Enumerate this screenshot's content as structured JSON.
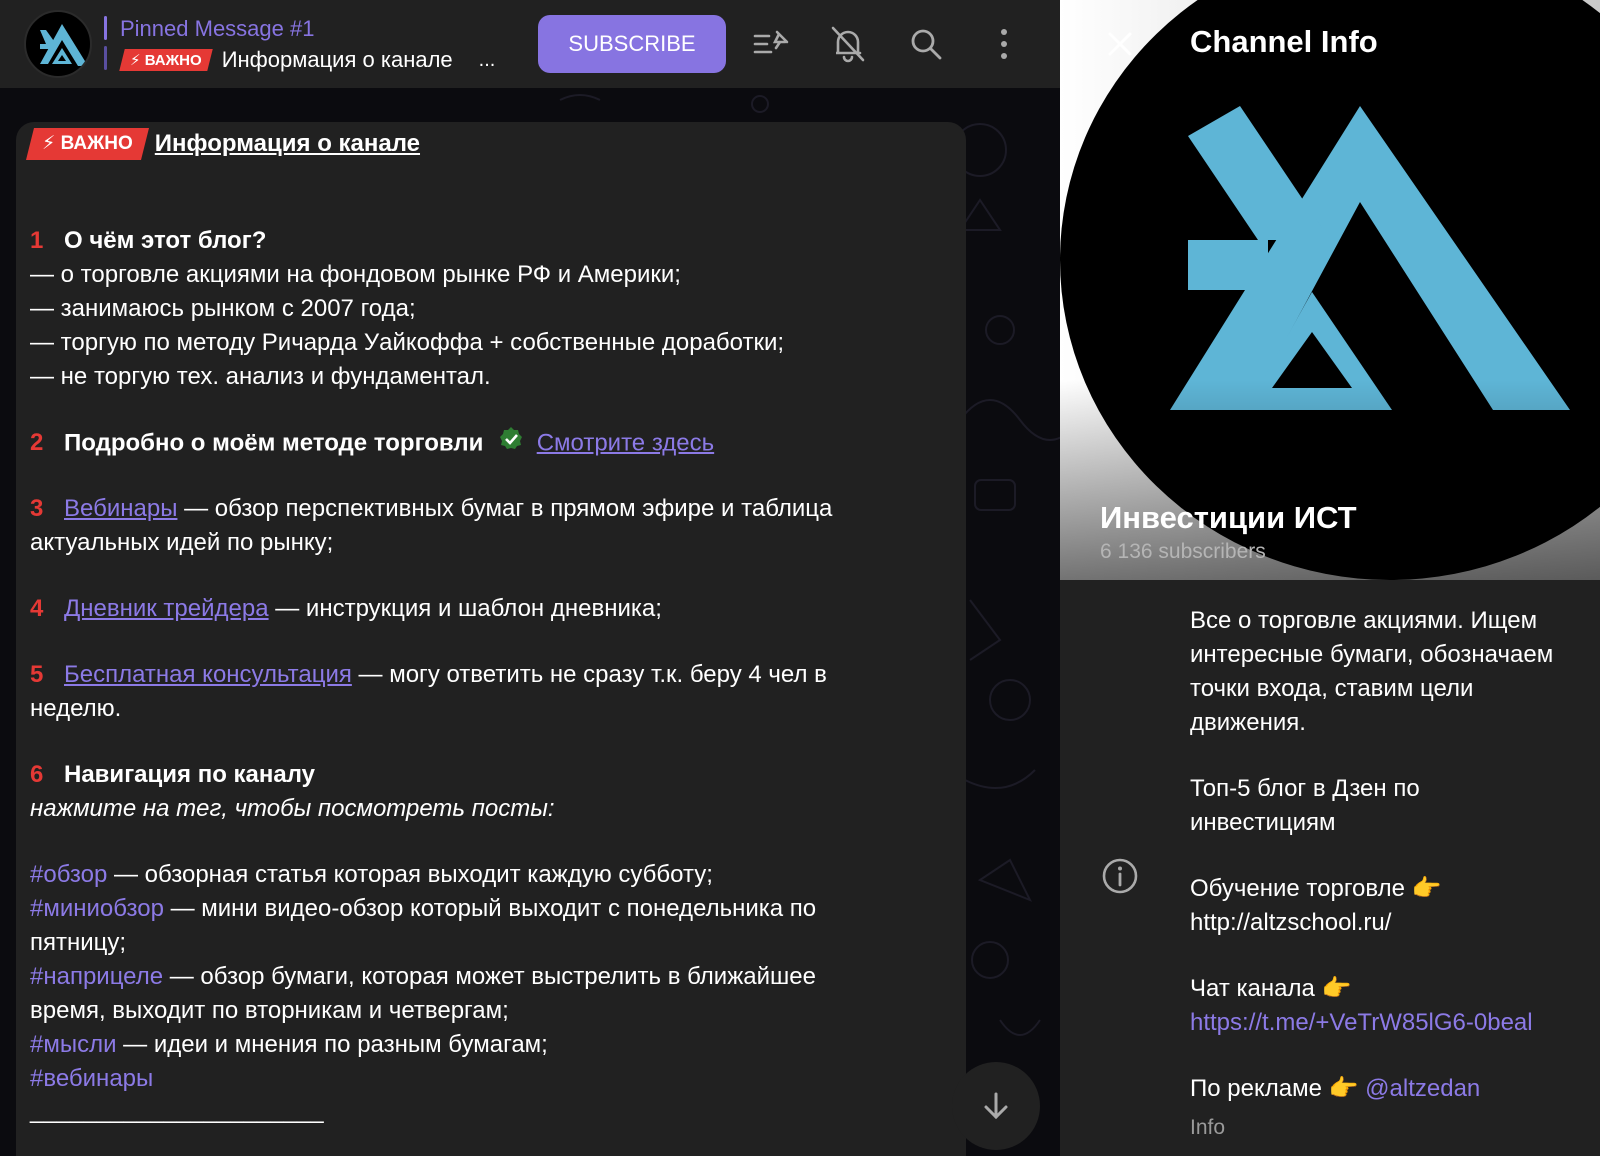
{
  "header": {
    "pinned_title": "Pinned Message #1",
    "pinned_badge": "⚡ ВАЖНО",
    "pinned_text": "Информация о канале",
    "pinned_ellipsis": "...",
    "subscribe_label": "SUBSCRIBE",
    "icons": [
      "unpin-list-icon",
      "bell-off-icon",
      "search-icon",
      "more-vertical-icon"
    ]
  },
  "message": {
    "badge": "⚡ ВАЖНО",
    "header_link": "Информация о канале",
    "s1_num": "1",
    "s1_title": "О чём этот блог?",
    "s1_lines": [
      "— о торговле акциями на фондовом рынке РФ и Америки;",
      "— занимаюсь рынком с 2007 года;",
      "— торгую по методу Ричарда Уайкоффа + собственные доработки;",
      "— не торгую тех. анализ и фундаментал."
    ],
    "s2_num": "2",
    "s2_title": "Подробно о моём методе торговли",
    "s2_link": "Смотрите здесь ",
    "s3_num": "3",
    "s3_link": "Вебинары",
    "s3_text": " — обзор перспективных бумаг в прямом эфире и таблица",
    "s3_cont": "актуальных идей по рынку;",
    "s4_num": "4",
    "s4_link": "Дневник трейдера",
    "s4_text": " — инструкция и шаблон дневника;",
    "s5_num": "5",
    "s5_link": "Бесплатная консультация",
    "s5_text": " — могу ответить не сразу т.к. беру 4 чел в",
    "s5_cont": "неделю.",
    "s6_num": "6",
    "s6_title": "Навигация по каналу",
    "s6_sub": "нажмите на тег, чтобы посмотреть посты:",
    "tag1": "#обзор",
    "tag1_text": " — обзорная статья которая выходит каждую субботу;",
    "tag2": "#миниобзор",
    "tag2_text": " — мини видео-обзор который выходит с понедельника по",
    "tag2_cont": "пятницу;",
    "tag3": "#наприцеле",
    "tag3_text": " — обзор бумаги, которая может выстрелить в ближайшее",
    "tag3_cont": "время, выходит по вторникам и четвергам;",
    "tag4": "#мысли",
    "tag4_text": " — идеи и мнения по разным бумагам;",
    "tag5": "#вебинары",
    "divider": "______________________"
  },
  "panel": {
    "title": "Channel Info",
    "channel_name": "Инвестиции ИСТ",
    "subscribers": "6 136 subscribers",
    "desc_lines": [
      "Все о торговле акциями. Ищем",
      "интересные бумаги, обозначаем",
      "точки входа, ставим цели",
      "движения."
    ],
    "top5_lines": [
      "Топ-5 блог в Дзен по",
      "инвестициям"
    ],
    "learn_text": "Обучение торговле 👉",
    "learn_url": "http://altzschool.ru/",
    "chat_text": "Чат канала 👉",
    "chat_url": "https://t.me/+VeTrW85lG6-0beal",
    "ads_text": "По рекламе 👉 ",
    "ads_handle": "@altzedan",
    "info_label": "Info"
  },
  "colors": {
    "accent": "#8774e1",
    "badge_red": "#e53935",
    "panel_bg": "#212121",
    "logo_blue": "#5eb5d6"
  }
}
